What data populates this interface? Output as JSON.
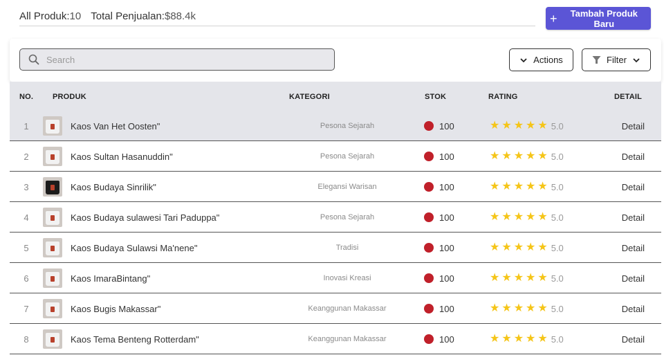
{
  "header": {
    "all_products_label": "All Produk:",
    "all_products_value": "10",
    "total_sales_label": "Total Penjualan:",
    "total_sales_value": "$88.4k",
    "add_button_label": "Tambah Produk Baru"
  },
  "toolbar": {
    "search_placeholder": "Search",
    "actions_label": "Actions",
    "filter_label": "Filter"
  },
  "table": {
    "columns": [
      "NO.",
      "PRODUK",
      "KATEGORI",
      "STOK",
      "RATING",
      "DETAIL"
    ],
    "stock_status_color": "#c0202a",
    "star_color": "#f5c518",
    "rows": [
      {
        "no": "1",
        "name": "Kaos Van Het Oosten\"",
        "category": "Pesona Sejarah",
        "stock": "100",
        "rating": "5.0",
        "stars": 5,
        "detail": "Detail"
      },
      {
        "no": "2",
        "name": "Kaos Sultan Hasanuddin\"",
        "category": "Pesona Sejarah",
        "stock": "100",
        "rating": "5.0",
        "stars": 5,
        "detail": "Detail"
      },
      {
        "no": "3",
        "name": "Kaos Budaya Sinrilik\"",
        "category": "Elegansi Warisan",
        "stock": "100",
        "rating": "5.0",
        "stars": 5,
        "detail": "Detail"
      },
      {
        "no": "4",
        "name": "Kaos Budaya sulawesi Tari Paduppa\"",
        "category": "Pesona Sejarah",
        "stock": "100",
        "rating": "5.0",
        "stars": 5,
        "detail": "Detail"
      },
      {
        "no": "5",
        "name": "Kaos Budaya Sulawsi Ma'nene\"",
        "category": "Tradisi",
        "stock": "100",
        "rating": "5.0",
        "stars": 5,
        "detail": "Detail"
      },
      {
        "no": "6",
        "name": "Kaos ImaraBintang\"",
        "category": "Inovasi Kreasi",
        "stock": "100",
        "rating": "5.0",
        "stars": 5,
        "detail": "Detail"
      },
      {
        "no": "7",
        "name": "Kaos Bugis Makassar\"",
        "category": "Keanggunan Makassar",
        "stock": "100",
        "rating": "5.0",
        "stars": 5,
        "detail": "Detail"
      },
      {
        "no": "8",
        "name": "Kaos Tema Benteng Rotterdam\"",
        "category": "Keanggunan Makassar",
        "stock": "100",
        "rating": "5.0",
        "stars": 5,
        "detail": "Detail"
      }
    ]
  }
}
